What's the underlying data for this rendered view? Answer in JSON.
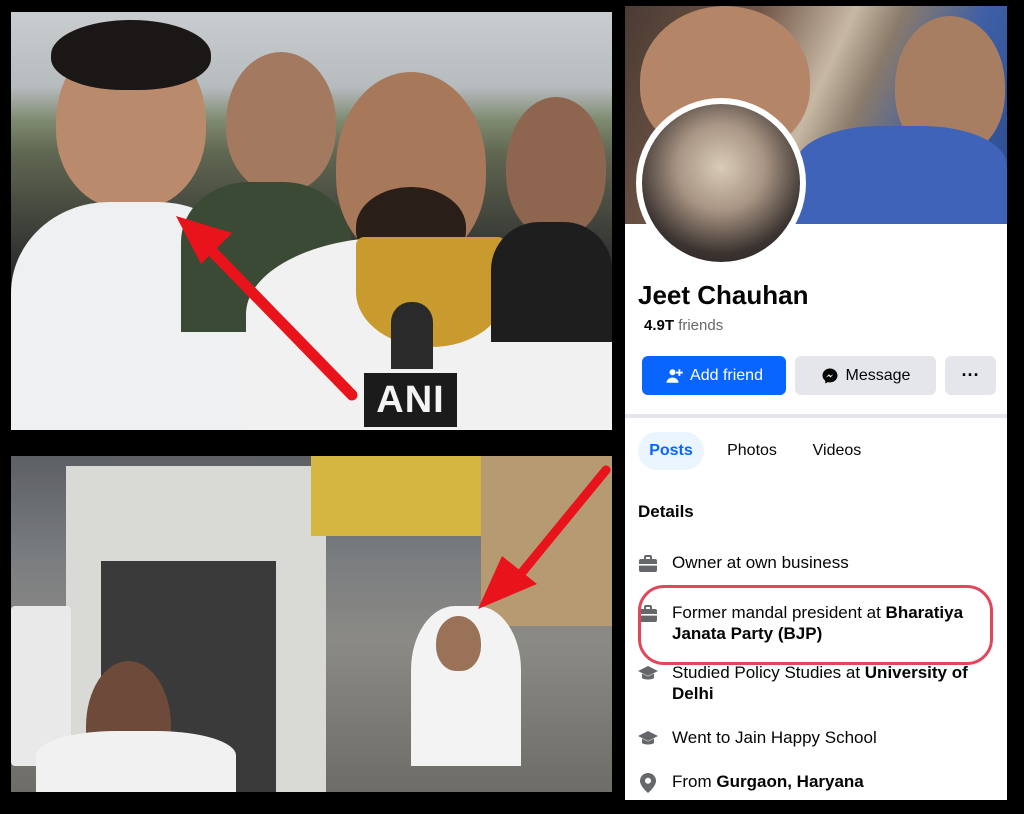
{
  "top_photo": {
    "mic_flag_text": "ANI"
  },
  "profile": {
    "name": "Jeet Chauhan",
    "friends_count": "4.9T",
    "friends_label": "friends"
  },
  "actions": {
    "add_friend_label": "Add friend",
    "message_label": "Message",
    "more_label": "···"
  },
  "tabs": [
    {
      "label": "Posts",
      "selected": true
    },
    {
      "label": "Photos",
      "selected": false
    },
    {
      "label": "Videos",
      "selected": false
    }
  ],
  "details": {
    "heading": "Details",
    "items": [
      {
        "icon": "briefcase-icon",
        "text": "Owner at own business",
        "bold": ""
      },
      {
        "icon": "briefcase-icon",
        "text": "Former mandal president at ",
        "bold": "Bharatiya Janata Party (BJP)"
      },
      {
        "icon": "graduation-cap-icon",
        "text": "Studied Policy Studies at ",
        "bold": "University of Delhi"
      },
      {
        "icon": "graduation-cap-icon",
        "text": "Went to Jain Happy School",
        "bold": ""
      },
      {
        "icon": "location-pin-icon",
        "text": "From ",
        "bold": "Gurgaon, Haryana"
      }
    ]
  },
  "colors": {
    "primary_blue": "#0866ff",
    "highlight_red": "#e0475a",
    "arrow_red": "#e8131b"
  }
}
